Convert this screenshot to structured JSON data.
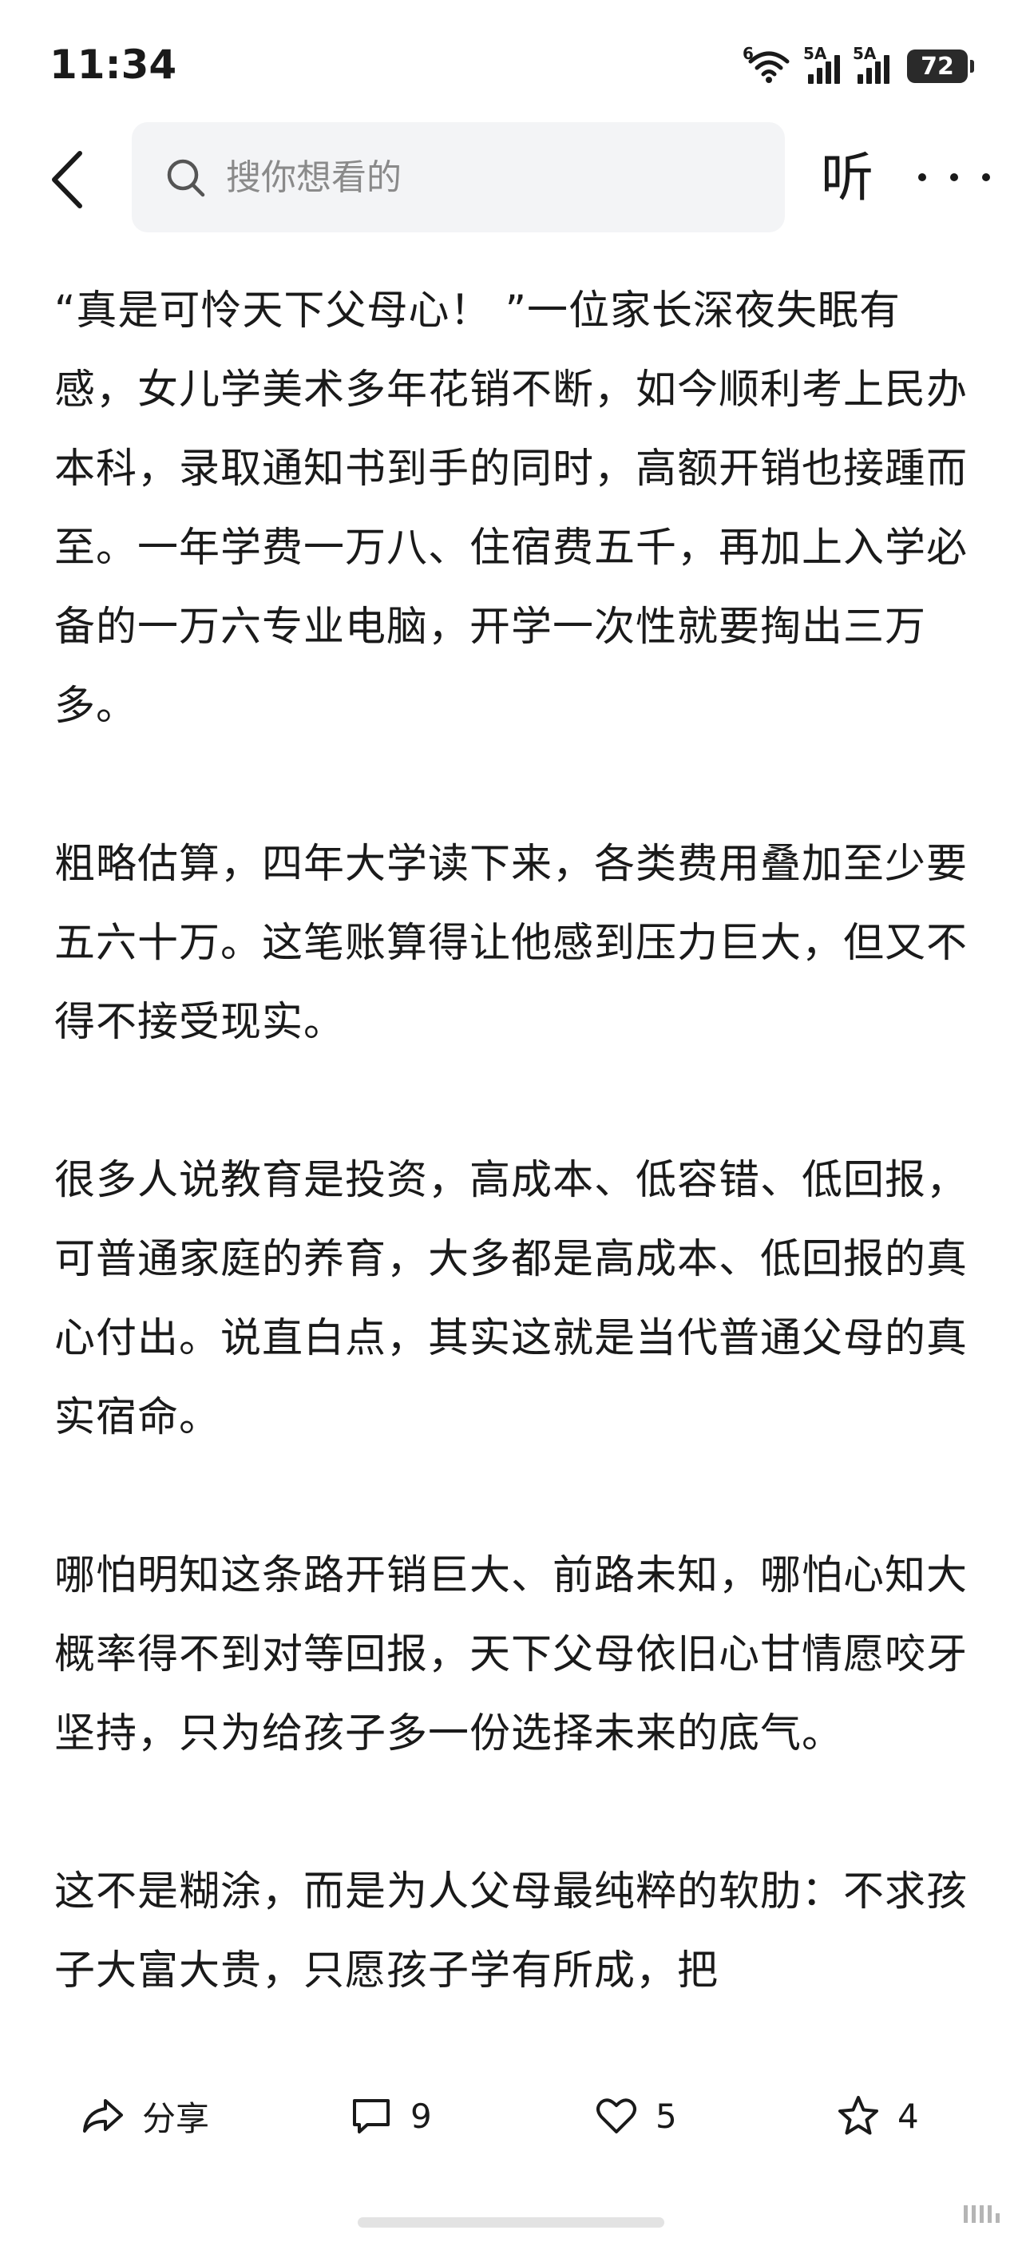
{
  "status_bar": {
    "time": "11:34",
    "wifi_label": "6",
    "signal1_label": "5A",
    "signal2_label": "5A",
    "battery": "72"
  },
  "nav": {
    "search_placeholder": "搜你想看的",
    "listen_label": "听"
  },
  "article": {
    "paragraphs": [
      "“真是可怜天下父母心！ ”一位家长深夜失眠有感，女儿学美术多年花销不断，如今顺利考上民办本科，录取通知书到手的同时，高额开销也接踵而至。一年学费一万八、住宿费五千，再加上入学必备的一万六专业电脑，开学一次性就要掏出三万多。",
      "粗略估算，四年大学读下来，各类费用叠加至少要五六十万。这笔账算得让他感到压力巨大，但又不得不接受现实。",
      "很多人说教育是投资，高成本、低容错、低回报，可普通家庭的养育，大多都是高成本、低回报的真心付出。说直白点，其实这就是当代普通父母的真实宿命。",
      "哪怕明知这条路开销巨大、前路未知，哪怕心知大概率得不到对等回报，天下父母依旧心甘情愿咬牙坚持，只为给孩子多一份选择未来的底气。",
      "这不是糊涂，而是为人父母最纯粹的软肋：不求孩子大富大贵，只愿孩子学有所成，把"
    ]
  },
  "actions": {
    "share_label": "分享",
    "comment_count": "9",
    "like_count": "5",
    "favorite_count": "4"
  }
}
